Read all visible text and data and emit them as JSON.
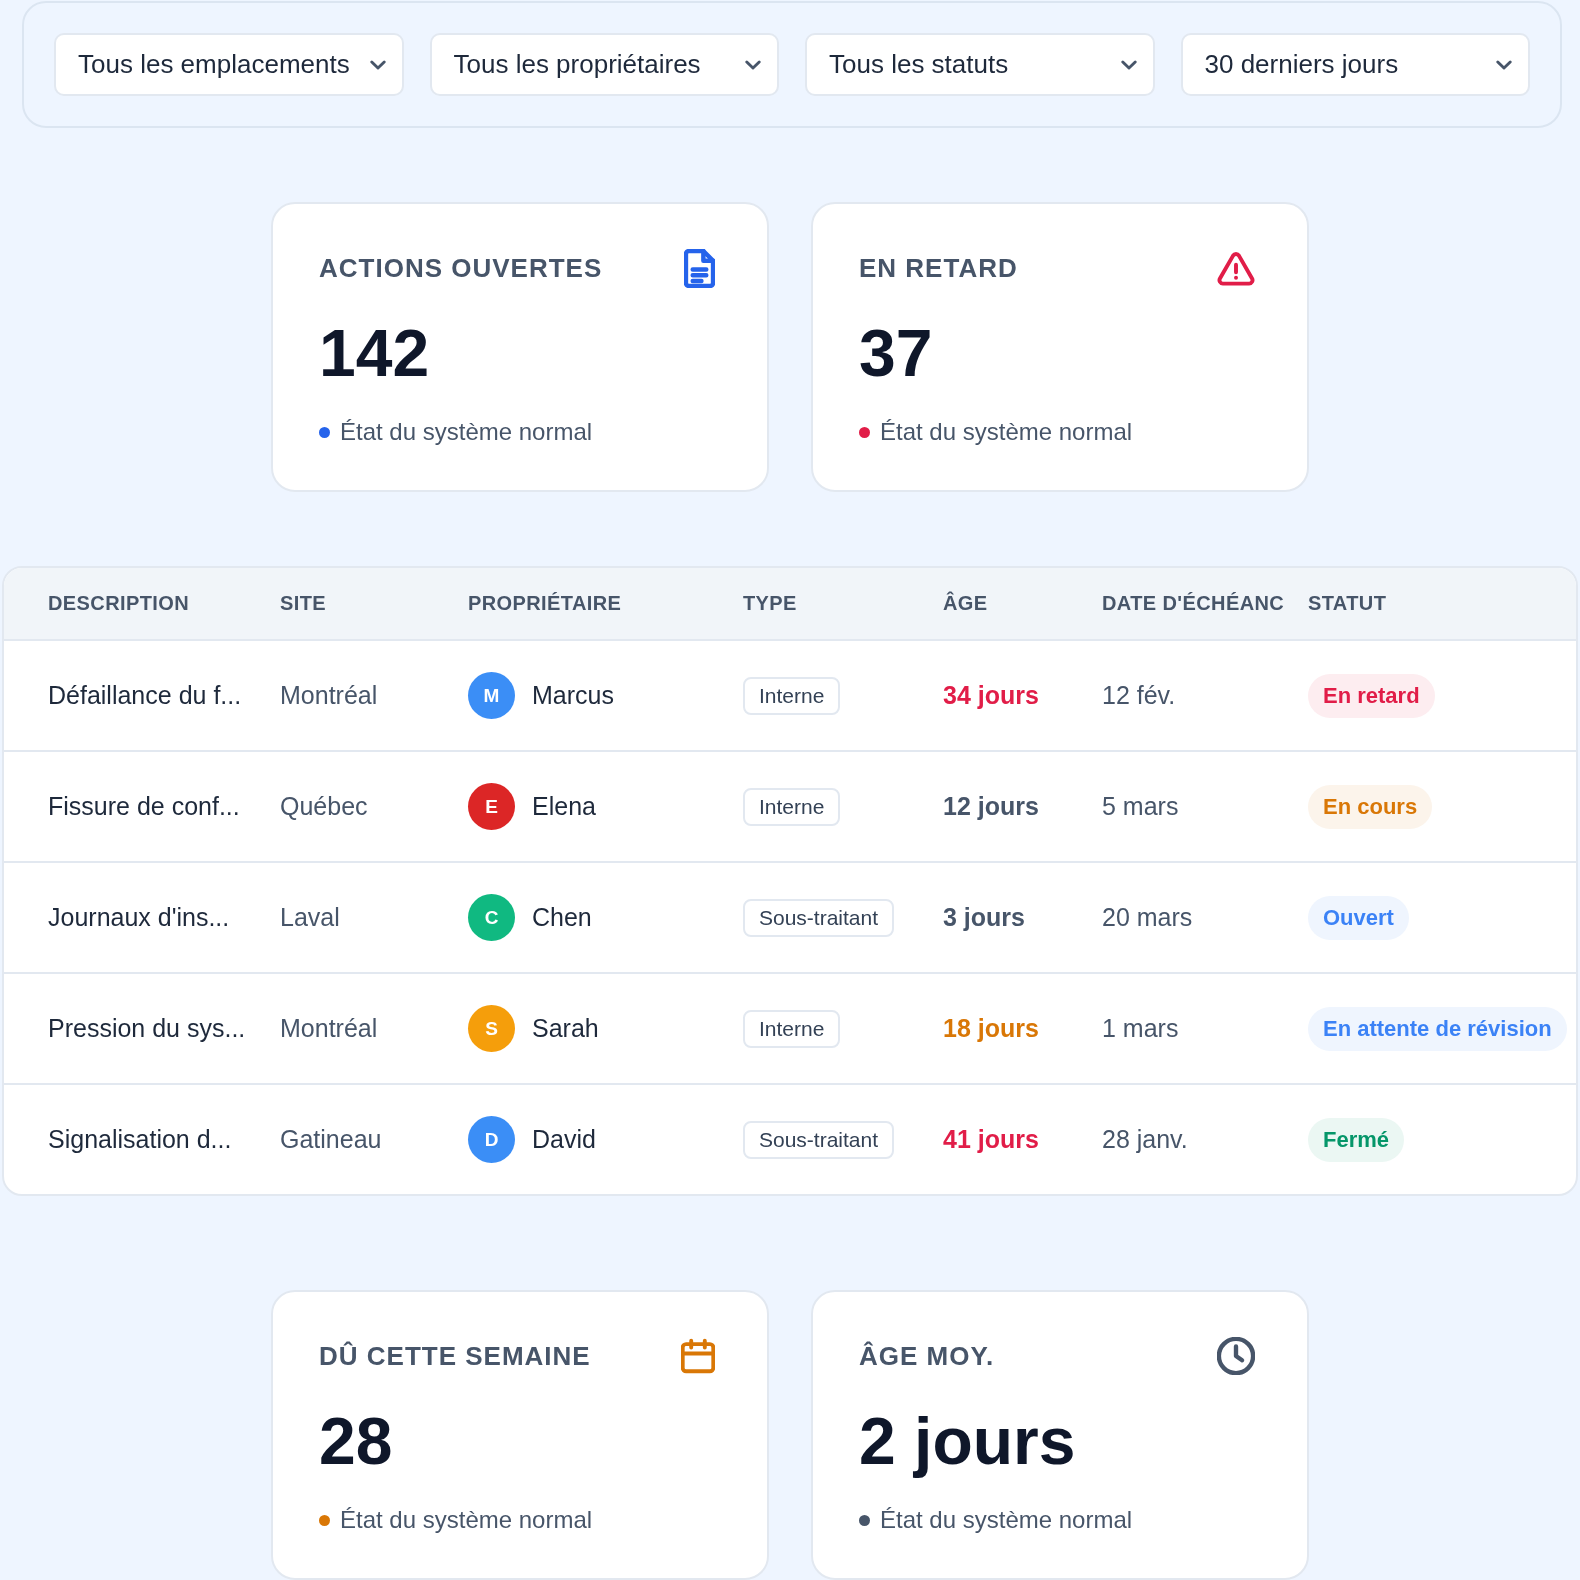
{
  "filters": [
    {
      "value": "Tous les emplacements"
    },
    {
      "value": "Tous les propriétaires"
    },
    {
      "value": "Tous les statuts"
    },
    {
      "value": "30 derniers jours"
    }
  ],
  "top_cards": [
    {
      "kind": "open",
      "title": "ACTIONS OUVERTES",
      "value": "142",
      "status": "État du système normal",
      "color": "#2563eb"
    },
    {
      "kind": "overdue",
      "title": "EN RETARD",
      "value": "37",
      "status": "État du système normal",
      "color": "#e11d48"
    }
  ],
  "table": {
    "columns": [
      "DESCRIPTION",
      "SITE",
      "PROPRIÉTAIRE",
      "TYPE",
      "ÂGE",
      "DATE D'ÉCHÉANC",
      "STATUT"
    ],
    "rows": [
      {
        "description": "Défaillance du f...",
        "site": "Montréal",
        "owner": {
          "initial": "M",
          "name": "Marcus",
          "color": "#3b8ef6"
        },
        "type": "Interne",
        "age": {
          "text": "34 jours",
          "color": "#e11d48"
        },
        "due": "12 fév.",
        "status": {
          "label": "En retard",
          "color": "#e11d48"
        }
      },
      {
        "description": "Fissure de conf...",
        "site": "Québec",
        "owner": {
          "initial": "E",
          "name": "Elena",
          "color": "#dc2626"
        },
        "type": "Interne",
        "age": {
          "text": "12 jours",
          "color": "#475569"
        },
        "due": "5 mars",
        "status": {
          "label": "En cours",
          "color": "#d97706"
        }
      },
      {
        "description": "Journaux d'ins...",
        "site": "Laval",
        "owner": {
          "initial": "C",
          "name": "Chen",
          "color": "#10b981"
        },
        "type": "Sous-traitant",
        "age": {
          "text": "3 jours",
          "color": "#475569"
        },
        "due": "20 mars",
        "status": {
          "label": "Ouvert",
          "color": "#3b82f6"
        }
      },
      {
        "description": "Pression du sys...",
        "site": "Montréal",
        "owner": {
          "initial": "S",
          "name": "Sarah",
          "color": "#f59e0b"
        },
        "type": "Interne",
        "age": {
          "text": "18 jours",
          "color": "#d97706"
        },
        "due": "1 mars",
        "status": {
          "label": "En attente de révision",
          "color": "#3b82f6"
        }
      },
      {
        "description": "Signalisation d...",
        "site": "Gatineau",
        "owner": {
          "initial": "D",
          "name": "David",
          "color": "#3b8ef6"
        },
        "type": "Sous-traitant",
        "age": {
          "text": "41 jours",
          "color": "#e11d48"
        },
        "due": "28 janv.",
        "status": {
          "label": "Fermé",
          "color": "#059669"
        }
      }
    ]
  },
  "bottom_cards": [
    {
      "kind": "due",
      "title": "DÛ CETTE SEMAINE",
      "value": "28",
      "status": "État du système normal",
      "color": "#d97706"
    },
    {
      "kind": "age",
      "title": "ÂGE MOY.",
      "value": "2 jours",
      "status": "État du système normal",
      "color": "#475569"
    }
  ]
}
